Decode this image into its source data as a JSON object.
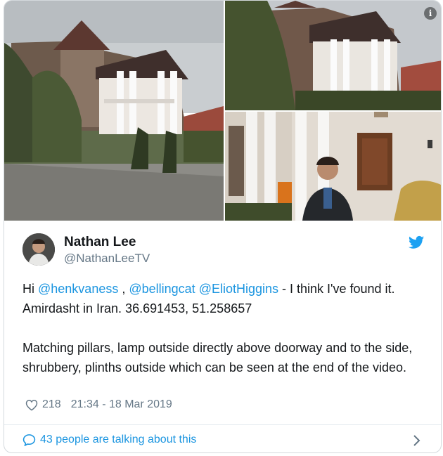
{
  "tweet": {
    "author_name": "Nathan Lee",
    "author_handle": "@NathanLeeTV",
    "text_prefix": "Hi ",
    "mention_1": "@henkvaness",
    "sep_1": " , ",
    "mention_2": "@bellingcat",
    "sep_2": " ",
    "mention_3": "@EliotHiggins",
    "text_rest": " - I think I've found it. Amirdasht in Iran. 36.691453, 51.258657",
    "text_para_2": "Matching pillars, lamp outside directly above doorway and to the side, shrubbery, plinths outside which can be seen at the end of the video.",
    "likes": "218",
    "timestamp": "21:34 - 18 Mar 2019",
    "conversation": "43 people are talking about this"
  },
  "colors": {
    "link": "#1b95e0",
    "text": "#14171a",
    "muted": "#657786"
  },
  "icons": [
    "info-icon",
    "twitter-bird-icon",
    "heart-icon",
    "comment-bubble-icon",
    "chevron-right-icon"
  ]
}
